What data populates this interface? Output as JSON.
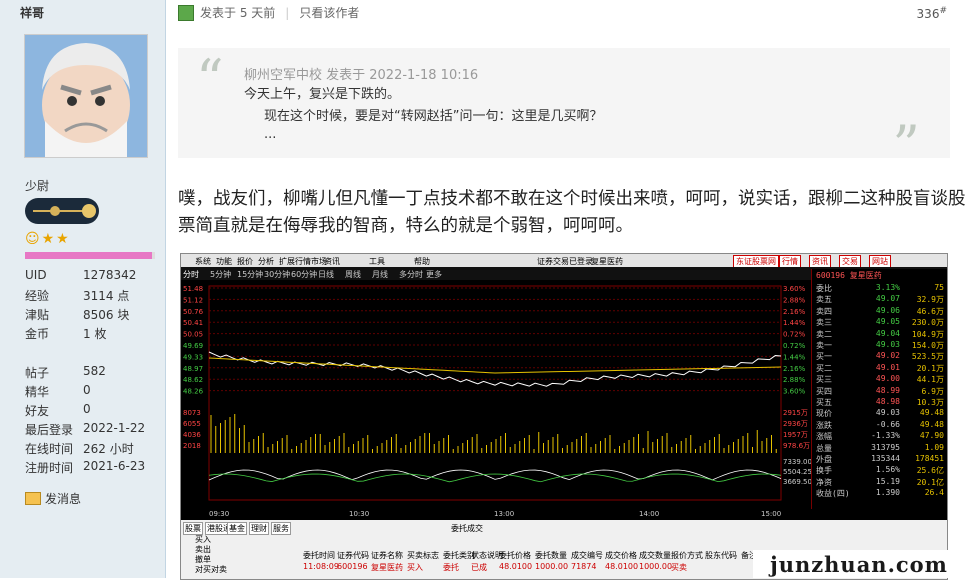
{
  "user": {
    "name": "祥哥",
    "rank": "少尉",
    "stats": [
      {
        "k": "UID",
        "v": "1278342"
      },
      {
        "k": "经验",
        "v": "3114 点"
      },
      {
        "k": "津贴",
        "v": "8506 块"
      },
      {
        "k": "金币",
        "v": "1 枚"
      }
    ],
    "stats2": [
      {
        "k": "帖子",
        "v": "582"
      },
      {
        "k": "精华",
        "v": "0"
      },
      {
        "k": "好友",
        "v": "0"
      },
      {
        "k": "最后登录",
        "v": "2022-1-22"
      },
      {
        "k": "在线时间",
        "v": "262 小时"
      },
      {
        "k": "注册时间",
        "v": "2021-6-23"
      }
    ],
    "progress": 0.98,
    "send_message": "发消息"
  },
  "post": {
    "posted": "发表于 5 天前",
    "only_author": "只看该作者",
    "floor": "336",
    "floor_suffix": "#",
    "quote_header": "柳州空军中校 发表于 2022-1-18 10:16",
    "quote_line1": "今天上午，复兴是下跌的。",
    "quote_line2": "现在这个时候，要是对“转网赵括”问一句：这里是几买啊？",
    "quote_ellipsis": "...",
    "body": "噗，战友们，柳嘴儿但凡懂一丁点技术都不敢在这个时候出来喷，呵呵，说实话，跟柳二这种股盲谈股票简直就是在侮辱我的智商，特么的就是个弱智，呵呵呵。"
  },
  "stock": {
    "menu": [
      "系统",
      "功能",
      "报价",
      "分析",
      "扩展行情市场",
      "资讯",
      "工具",
      "帮助"
    ],
    "title": "证券交易已登录",
    "name": "复星医药",
    "tabs": [
      "分时",
      "5分钟",
      "15分钟",
      "30分钟",
      "60分钟",
      "日线",
      "周线",
      "月线",
      "多分时",
      "更多"
    ],
    "right_buttons": [
      "东证股票网",
      "行情",
      "资讯",
      "交易",
      "网站"
    ],
    "code": "600196",
    "prices_left": [
      "51.48",
      "51.12",
      "50.76",
      "50.41",
      "50.05",
      "49.69",
      "49.33",
      "48.97",
      "48.62",
      "48.26"
    ],
    "pct_right": [
      "3.60%",
      "2.88%",
      "2.16%",
      "1.44%",
      "0.72%",
      "0.72%",
      "1.44%",
      "2.16%",
      "2.88%",
      "3.60%"
    ],
    "vol_left": [
      "8073",
      "6055",
      "4036",
      "2018"
    ],
    "vol_right": [
      "2915万",
      "2936万",
      "1957万",
      "978.6万"
    ],
    "macd_right": [
      "7339.00",
      "5504.25",
      "3669.50"
    ],
    "times": [
      "09:30",
      "10:30",
      "13:00",
      "14:00",
      "15:00"
    ],
    "quotes": [
      {
        "a": "委比",
        "b": "3.13%",
        "c": "75"
      },
      {
        "a": "卖五",
        "b": "49.07",
        "c": "32.9万"
      },
      {
        "a": "卖四",
        "b": "49.06",
        "c": "46.6万"
      },
      {
        "a": "卖三",
        "b": "49.05",
        "c": "230.0万"
      },
      {
        "a": "卖二",
        "b": "49.04",
        "c": "104.9万"
      },
      {
        "a": "卖一",
        "b": "49.03",
        "c": "154.0万"
      },
      {
        "a": "买一",
        "b": "49.02",
        "c": "523.5万"
      },
      {
        "a": "买二",
        "b": "49.01",
        "c": "20.1万"
      },
      {
        "a": "买三",
        "b": "49.00",
        "c": "44.1万"
      },
      {
        "a": "买四",
        "b": "48.99",
        "c": "6.9万"
      },
      {
        "a": "买五",
        "b": "48.98",
        "c": "10.3万"
      },
      {
        "a": "现价",
        "b": "49.03",
        "c": "49.48"
      },
      {
        "a": "涨跌",
        "b": "-0.66",
        "c": "49.48"
      },
      {
        "a": "涨幅",
        "b": "-1.33%",
        "c": "47.90"
      },
      {
        "a": "总量",
        "b": "313795",
        "c": "1.09"
      },
      {
        "a": "外盘",
        "b": "135344",
        "c": "178451"
      },
      {
        "a": "换手",
        "b": "1.56%",
        "c": "25.6亿"
      },
      {
        "a": "净资",
        "b": "15.19",
        "c": "20.1亿"
      },
      {
        "a": "收益(四)",
        "b": "1.390",
        "c": "26.4"
      }
    ],
    "panel_header": "委托成交",
    "panel_cols": [
      "委托时间",
      "证券代码",
      "证券名称",
      "买卖标志",
      "委托类别",
      "状态说明",
      "委托价格",
      "委托数量",
      "成交编号",
      "成交价格",
      "成交数量",
      "报价方式",
      "股东代码",
      "备注"
    ],
    "panel_row": [
      "11:08:09",
      "600196",
      "复星医药",
      "买入",
      "委托",
      "已成",
      "48.0100",
      "1000.00",
      "71874",
      "48.0100",
      "1000.00",
      "买卖"
    ],
    "panel_left": [
      "股票",
      "港股通",
      "基金",
      "理财",
      "服务"
    ],
    "panel_left_items": [
      "买入",
      "卖出",
      "撤单",
      "对买对卖"
    ]
  },
  "watermark": "junzhuan.com"
}
